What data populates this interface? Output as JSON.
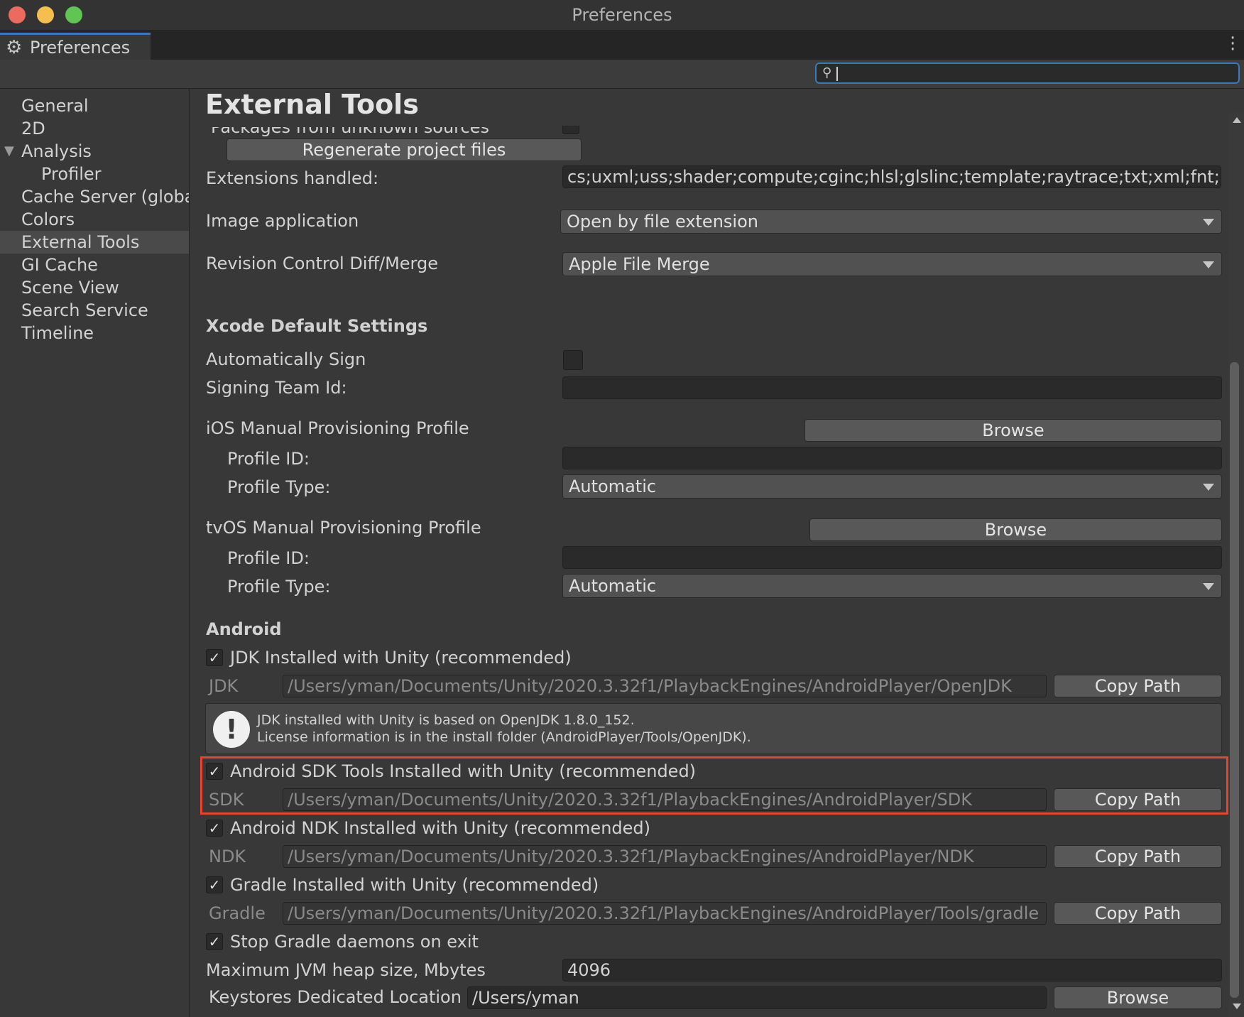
{
  "window": {
    "title": "Preferences"
  },
  "tab": {
    "label": "Preferences",
    "icon": "gear-icon"
  },
  "search": {
    "value": "",
    "icon": "search-icon"
  },
  "sidebar": {
    "items": [
      {
        "label": "General"
      },
      {
        "label": "2D"
      },
      {
        "label": "Analysis",
        "expanded": true
      },
      {
        "label": "Profiler"
      },
      {
        "label": "Cache Server (global)"
      },
      {
        "label": "Colors"
      },
      {
        "label": "External Tools",
        "selected": true
      },
      {
        "label": "GI Cache"
      },
      {
        "label": "Scene View"
      },
      {
        "label": "Search Service"
      },
      {
        "label": "Timeline"
      }
    ]
  },
  "main": {
    "title": "External Tools",
    "packages_unknown_label": "Packages from unknown sources",
    "regenerate_button": "Regenerate project files",
    "extensions_label": "Extensions handled:",
    "extensions_value": "cs;uxml;uss;shader;compute;cginc;hlsl;glslinc;template;raytrace;txt;xml;fnt;cd;asmdef",
    "image_app_label": "Image application",
    "image_app_value": "Open by file extension",
    "revision_label": "Revision Control Diff/Merge",
    "revision_value": "Apple File Merge",
    "xcode": {
      "header": "Xcode Default Settings",
      "auto_sign_label": "Automatically Sign",
      "signing_team_label": "Signing Team Id:",
      "signing_team_value": "",
      "ios_profile_label": "iOS Manual Provisioning Profile",
      "ios_browse": "Browse",
      "ios_profile_id_label": "Profile ID:",
      "ios_profile_id_value": "",
      "ios_profile_type_label": "Profile Type:",
      "ios_profile_type_value": "Automatic",
      "tvos_profile_label": "tvOS Manual Provisioning Profile",
      "tvos_browse": "Browse",
      "tvos_profile_id_label": "Profile ID:",
      "tvos_profile_id_value": "",
      "tvos_profile_type_label": "Profile Type:",
      "tvos_profile_type_value": "Automatic"
    },
    "android": {
      "header": "Android",
      "jdk_checkbox_label": "JDK Installed with Unity (recommended)",
      "jdk_label": "JDK",
      "jdk_path": "/Users/yman/Documents/Unity/2020.3.32f1/PlaybackEngines/AndroidPlayer/OpenJDK",
      "jdk_copy": "Copy Path",
      "jdk_info_line1": "JDK installed with Unity is based on OpenJDK 1.8.0_152.",
      "jdk_info_line2": "License information is in the install folder (AndroidPlayer/Tools/OpenJDK).",
      "sdk_checkbox_label": "Android SDK Tools Installed with Unity (recommended)",
      "sdk_label": "SDK",
      "sdk_path": "/Users/yman/Documents/Unity/2020.3.32f1/PlaybackEngines/AndroidPlayer/SDK",
      "sdk_copy": "Copy Path",
      "ndk_checkbox_label": "Android NDK Installed with Unity (recommended)",
      "ndk_label": "NDK",
      "ndk_path": "/Users/yman/Documents/Unity/2020.3.32f1/PlaybackEngines/AndroidPlayer/NDK",
      "ndk_copy": "Copy Path",
      "gradle_checkbox_label": "Gradle Installed with Unity (recommended)",
      "gradle_label": "Gradle",
      "gradle_path": "/Users/yman/Documents/Unity/2020.3.32f1/PlaybackEngines/AndroidPlayer/Tools/gradle",
      "gradle_copy": "Copy Path",
      "stop_gradle_label": "Stop Gradle daemons on exit",
      "jvm_heap_label": "Maximum JVM heap size, Mbytes",
      "jvm_heap_value": "4096",
      "keystores_label": "Keystores Dedicated Location",
      "keystores_value": "/Users/yman",
      "keystores_browse": "Browse",
      "check_mark": "✓"
    }
  },
  "colors": {
    "accent": "#3a79bb",
    "highlight": "#e8432f",
    "background": "#383838"
  }
}
